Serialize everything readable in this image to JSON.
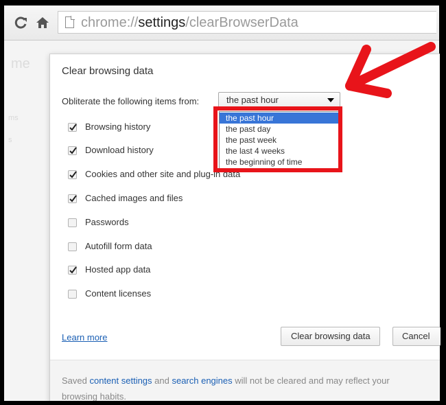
{
  "browser": {
    "url_scheme": "chrome://",
    "url_host": "settings",
    "url_path": "/clearBrowserData",
    "back_icon": "reload-icon",
    "home_icon": "home-icon"
  },
  "background": {
    "partial_title": "me",
    "side_text_1": "ms",
    "side_text_2": "s"
  },
  "dialog": {
    "title": "Clear browsing data",
    "obliterate_label": "Obliterate the following items from:",
    "selected_range": "the past hour",
    "range_options": [
      "the past hour",
      "the past day",
      "the past week",
      "the last 4 weeks",
      "the beginning of time"
    ],
    "items": [
      {
        "label": "Browsing history",
        "checked": true
      },
      {
        "label": "Download history",
        "checked": true
      },
      {
        "label": "Cookies and other site and plug-in data",
        "checked": true
      },
      {
        "label": "Cached images and files",
        "checked": true
      },
      {
        "label": "Passwords",
        "checked": false
      },
      {
        "label": "Autofill form data",
        "checked": false
      },
      {
        "label": "Hosted app data",
        "checked": true
      },
      {
        "label": "Content licenses",
        "checked": false
      }
    ],
    "learn_more": "Learn more",
    "clear_button": "Clear browsing data",
    "cancel_button": "Cancel",
    "footer": {
      "prefix": "Saved ",
      "content_settings_link": "content settings",
      "middle": " and ",
      "search_engines_link": "search engines",
      "suffix": " will not be cleared and may reflect your browsing habits."
    }
  },
  "colors": {
    "highlight_red": "#e8141a",
    "selected_option_bg": "#3875d7",
    "link_blue": "#1a5fb4"
  }
}
